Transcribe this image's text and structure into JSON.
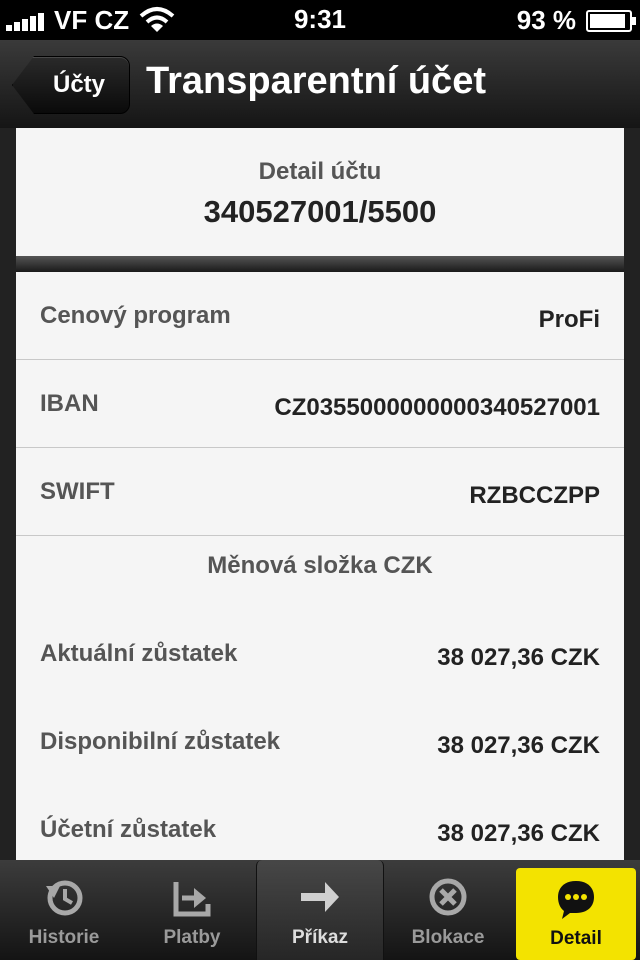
{
  "status_bar": {
    "carrier": "VF CZ",
    "time": "9:31",
    "battery": "93 %",
    "battery_level": 0.93
  },
  "nav": {
    "back_label": "Účty",
    "title": "Transparentní účet"
  },
  "header": {
    "detail_label": "Detail účtu",
    "account_number": "340527001/5500"
  },
  "rows": [
    {
      "label": "Cenový program",
      "value": "ProFi"
    },
    {
      "label": "IBAN",
      "value": "CZ0355000000000340527001"
    },
    {
      "label": "SWIFT",
      "value": "RZBCCZPP"
    }
  ],
  "currency_section": {
    "title": "Měnová složka CZK",
    "rows": [
      {
        "label": "Aktuální zůstatek",
        "value": "38 027,36 CZK"
      },
      {
        "label": "Disponibilní zůstatek",
        "value": "38 027,36 CZK"
      },
      {
        "label": "Účetní zůstatek",
        "value": "38 027,36 CZK"
      }
    ]
  },
  "tabs": [
    {
      "label": "Historie",
      "icon": "history-icon"
    },
    {
      "label": "Platby",
      "icon": "payments-icon"
    },
    {
      "label": "Příkaz",
      "icon": "arrow-right-icon",
      "state": "selected"
    },
    {
      "label": "Blokace",
      "icon": "blocked-icon"
    },
    {
      "label": "Detail",
      "icon": "speech-bubble-icon",
      "state": "highlighted"
    }
  ],
  "colors": {
    "accent_yellow": "#f3e300",
    "card_bg": "#f5f5f5"
  }
}
